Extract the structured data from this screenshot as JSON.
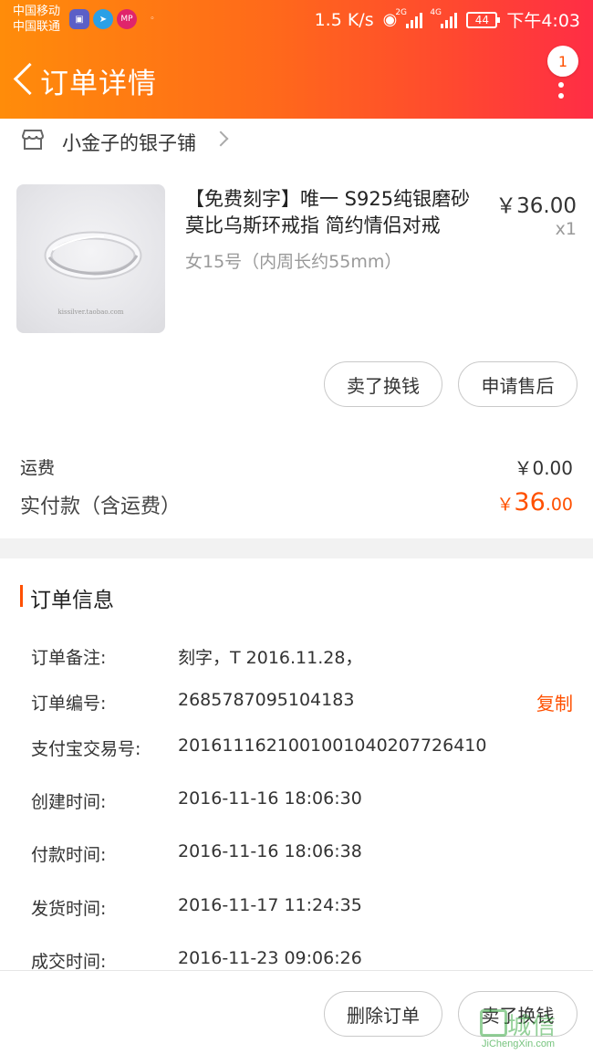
{
  "status_bar": {
    "carrier1": "中国移动",
    "carrier2": "中国联通",
    "net_speed": "1.5 K/s",
    "net_2g": "2G",
    "net_4g": "4G",
    "battery": "44",
    "time": "下午4:03"
  },
  "nav": {
    "title": "订单详情",
    "badge_count": "1"
  },
  "shop": {
    "name": "小金子的银子铺"
  },
  "product": {
    "title": "【免费刻字】唯一 S925纯银磨砂莫比乌斯环戒指 简约情侣对戒",
    "price": "￥36.00",
    "quantity": "x1",
    "spec": "女15号（内周长约55mm）",
    "image_caption": "kissilver.taobao.com"
  },
  "actions": {
    "sell": "卖了换钱",
    "after_sale": "申请售后"
  },
  "totals": {
    "shipping_label": "运费",
    "shipping_value": "￥0.00",
    "paid_label": "实付款（含运费）",
    "paid_currency": "￥",
    "paid_int": "36",
    "paid_dec": ".00"
  },
  "order_info": {
    "section_title": "订单信息",
    "copy_label": "复制",
    "fields": [
      {
        "label": "订单备注:",
        "value": "刻字，T  2016.11.28，"
      },
      {
        "label": "订单编号:",
        "value": "2685787095104183"
      },
      {
        "label": "支付宝交易号:",
        "value": "2016111621001001040207726410"
      },
      {
        "label": "创建时间:",
        "value": "2016-11-16 18:06:30"
      },
      {
        "label": "付款时间:",
        "value": "2016-11-16 18:06:38"
      },
      {
        "label": "发货时间:",
        "value": "2016-11-17 11:24:35"
      },
      {
        "label": "成交时间:",
        "value": "2016-11-23 09:06:26"
      }
    ]
  },
  "bottom_bar": {
    "delete": "删除订单",
    "sell": "卖了换钱"
  },
  "watermark": {
    "text": "城信",
    "site": "JiChengXin.com"
  },
  "colors": {
    "accent": "#ff5000",
    "header_start": "#ff8c0a",
    "header_end": "#ff2d45"
  }
}
